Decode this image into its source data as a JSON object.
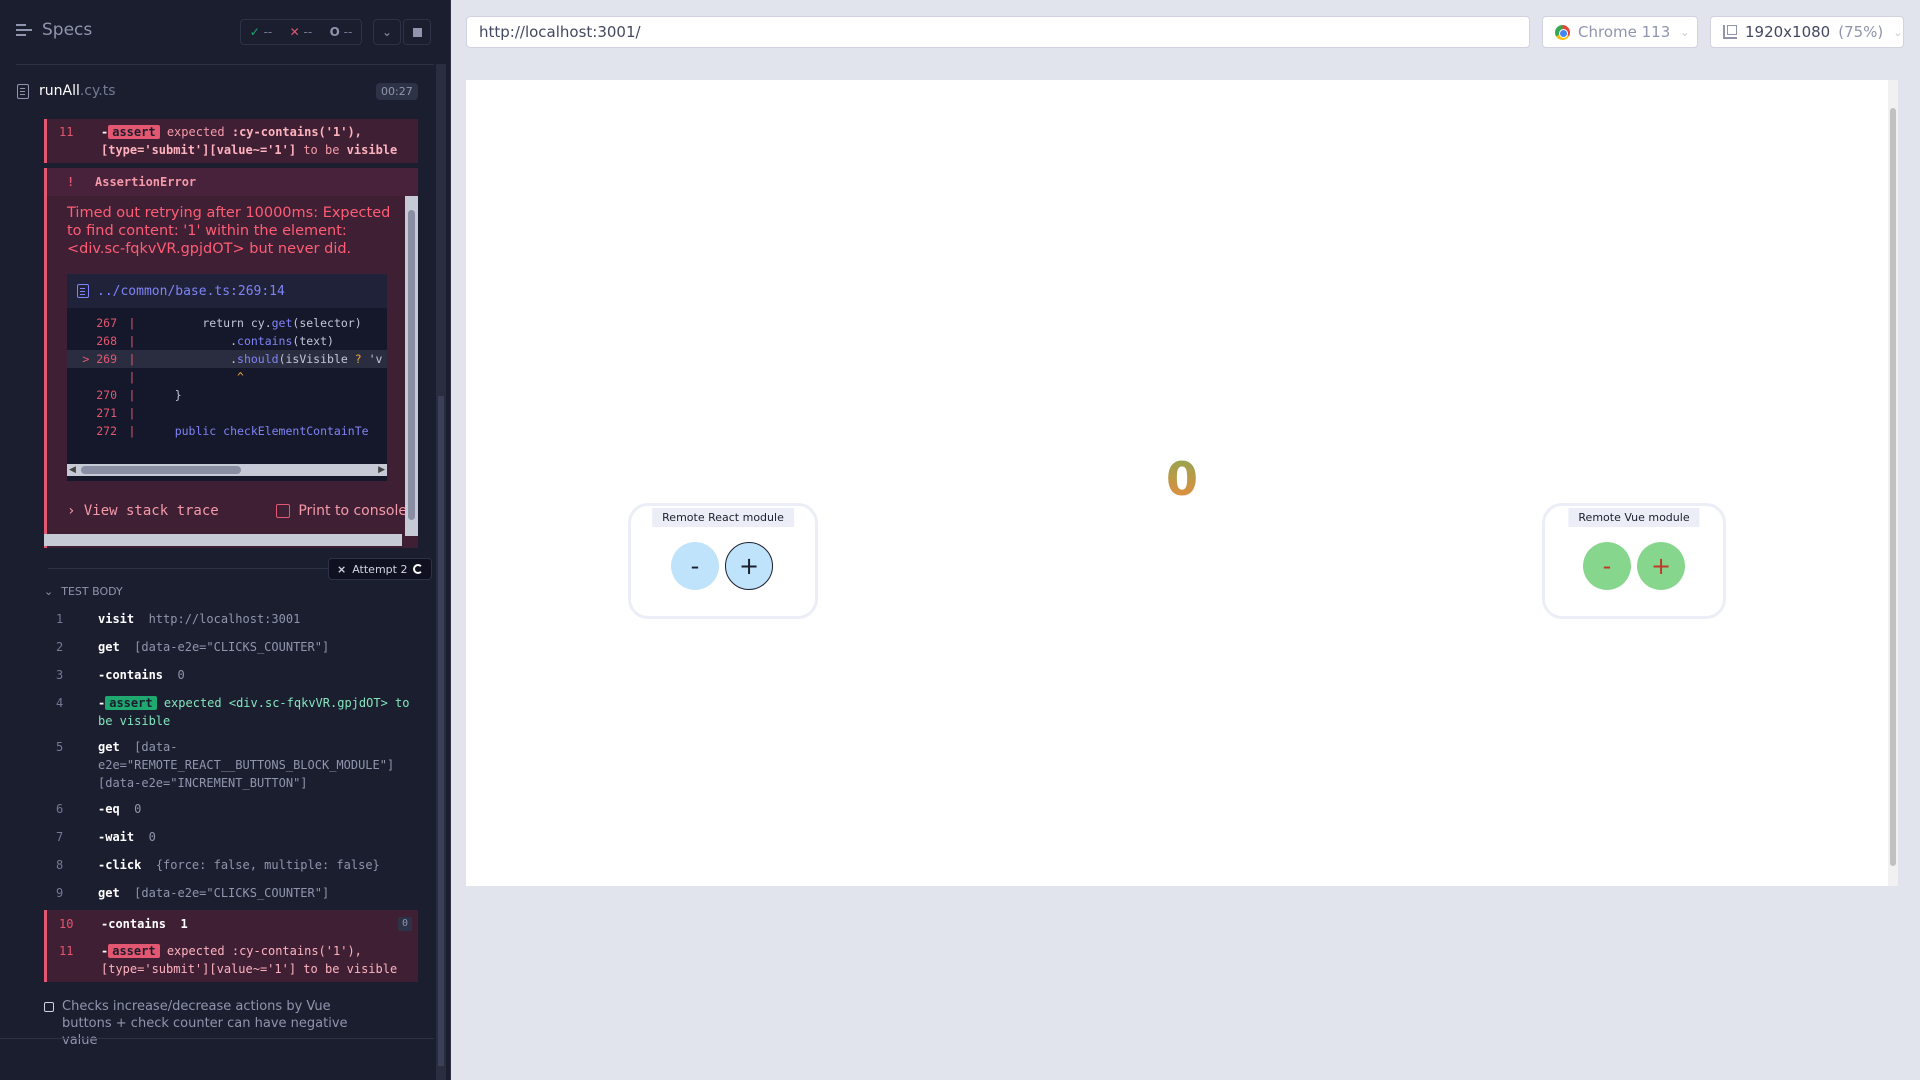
{
  "reporter": {
    "specs_label": "Specs",
    "stats": {
      "passed": "--",
      "failed": "--",
      "pending": "--"
    },
    "spec_name": "runAll",
    "spec_ext": ".cy.ts",
    "duration": "00:27"
  },
  "failed_top": {
    "num": "11",
    "badge": "assert",
    "text1": "expected",
    "selector": ":cy-contains('1'), [type='submit'][value~='1']",
    "tobe": "to be",
    "visible": "visible"
  },
  "error": {
    "title": "AssertionError",
    "message": "Timed out retrying after 10000ms: Expected to find content: '1' within the element: <div.sc-fqkvVR.gpjdOT> but never did.",
    "file": "../common/base.ts:269:14",
    "code": [
      {
        "ln": "267",
        "src": "        return cy.get(selector)"
      },
      {
        "ln": "268",
        "src": "            .contains(text)"
      },
      {
        "ln": "> 269",
        "src": "            .should(isVisible ? 'v"
      },
      {
        "ln": "",
        "src": "             ^"
      },
      {
        "ln": "270",
        "src": "    }"
      },
      {
        "ln": "271",
        "src": ""
      },
      {
        "ln": "272",
        "src": "    public checkElementContainTe"
      }
    ],
    "view_stack": "View stack trace",
    "print_console": "Print to console"
  },
  "attempt_label": "Attempt 2",
  "test_body_label": "TEST BODY",
  "commands": [
    {
      "num": "1",
      "name": "visit",
      "arg": "http://localhost:3001"
    },
    {
      "num": "2",
      "name": "get",
      "arg": "[data-e2e=\"CLICKS_COUNTER\"]"
    },
    {
      "num": "3",
      "name": "-contains",
      "arg": "0"
    },
    {
      "num": "4",
      "name": "assert",
      "arg": "expected <div.sc-fqkvVR.gpjdOT> to be visible"
    },
    {
      "num": "5",
      "name": "get",
      "arg": "[data-e2e=\"REMOTE_REACT__BUTTONS_BLOCK_MODULE\"] [data-e2e=\"INCREMENT_BUTTON\"]"
    },
    {
      "num": "6",
      "name": "-eq",
      "arg": "0"
    },
    {
      "num": "7",
      "name": "-wait",
      "arg": "0"
    },
    {
      "num": "8",
      "name": "-click",
      "arg": "{force: false, multiple: false}"
    },
    {
      "num": "9",
      "name": "get",
      "arg": "[data-e2e=\"CLICKS_COUNTER\"]"
    },
    {
      "num": "10",
      "name": "-contains",
      "arg": "1",
      "count": "0"
    },
    {
      "num": "11",
      "name": "assert",
      "arg": "expected :cy-contains('1'), [type='submit'][value~='1'] to be visible"
    }
  ],
  "next_test": "Checks increase/decrease actions by Vue buttons + check counter can have negative value",
  "browser": {
    "url": "http://localhost:3001/",
    "name": "Chrome 113",
    "viewport": "1920x1080",
    "zoom": "(75%)"
  },
  "aut": {
    "react_module_title": "Remote React module",
    "vue_module_title": "Remote Vue module",
    "minus": "-",
    "plus": "+",
    "counter": "0"
  },
  "colors": {
    "reporter_bg": "#1b1e2e",
    "fail": "#e45770",
    "pass": "#1fa971",
    "react_btn": "#bfe3fb",
    "vue_btn": "#86d78d"
  }
}
